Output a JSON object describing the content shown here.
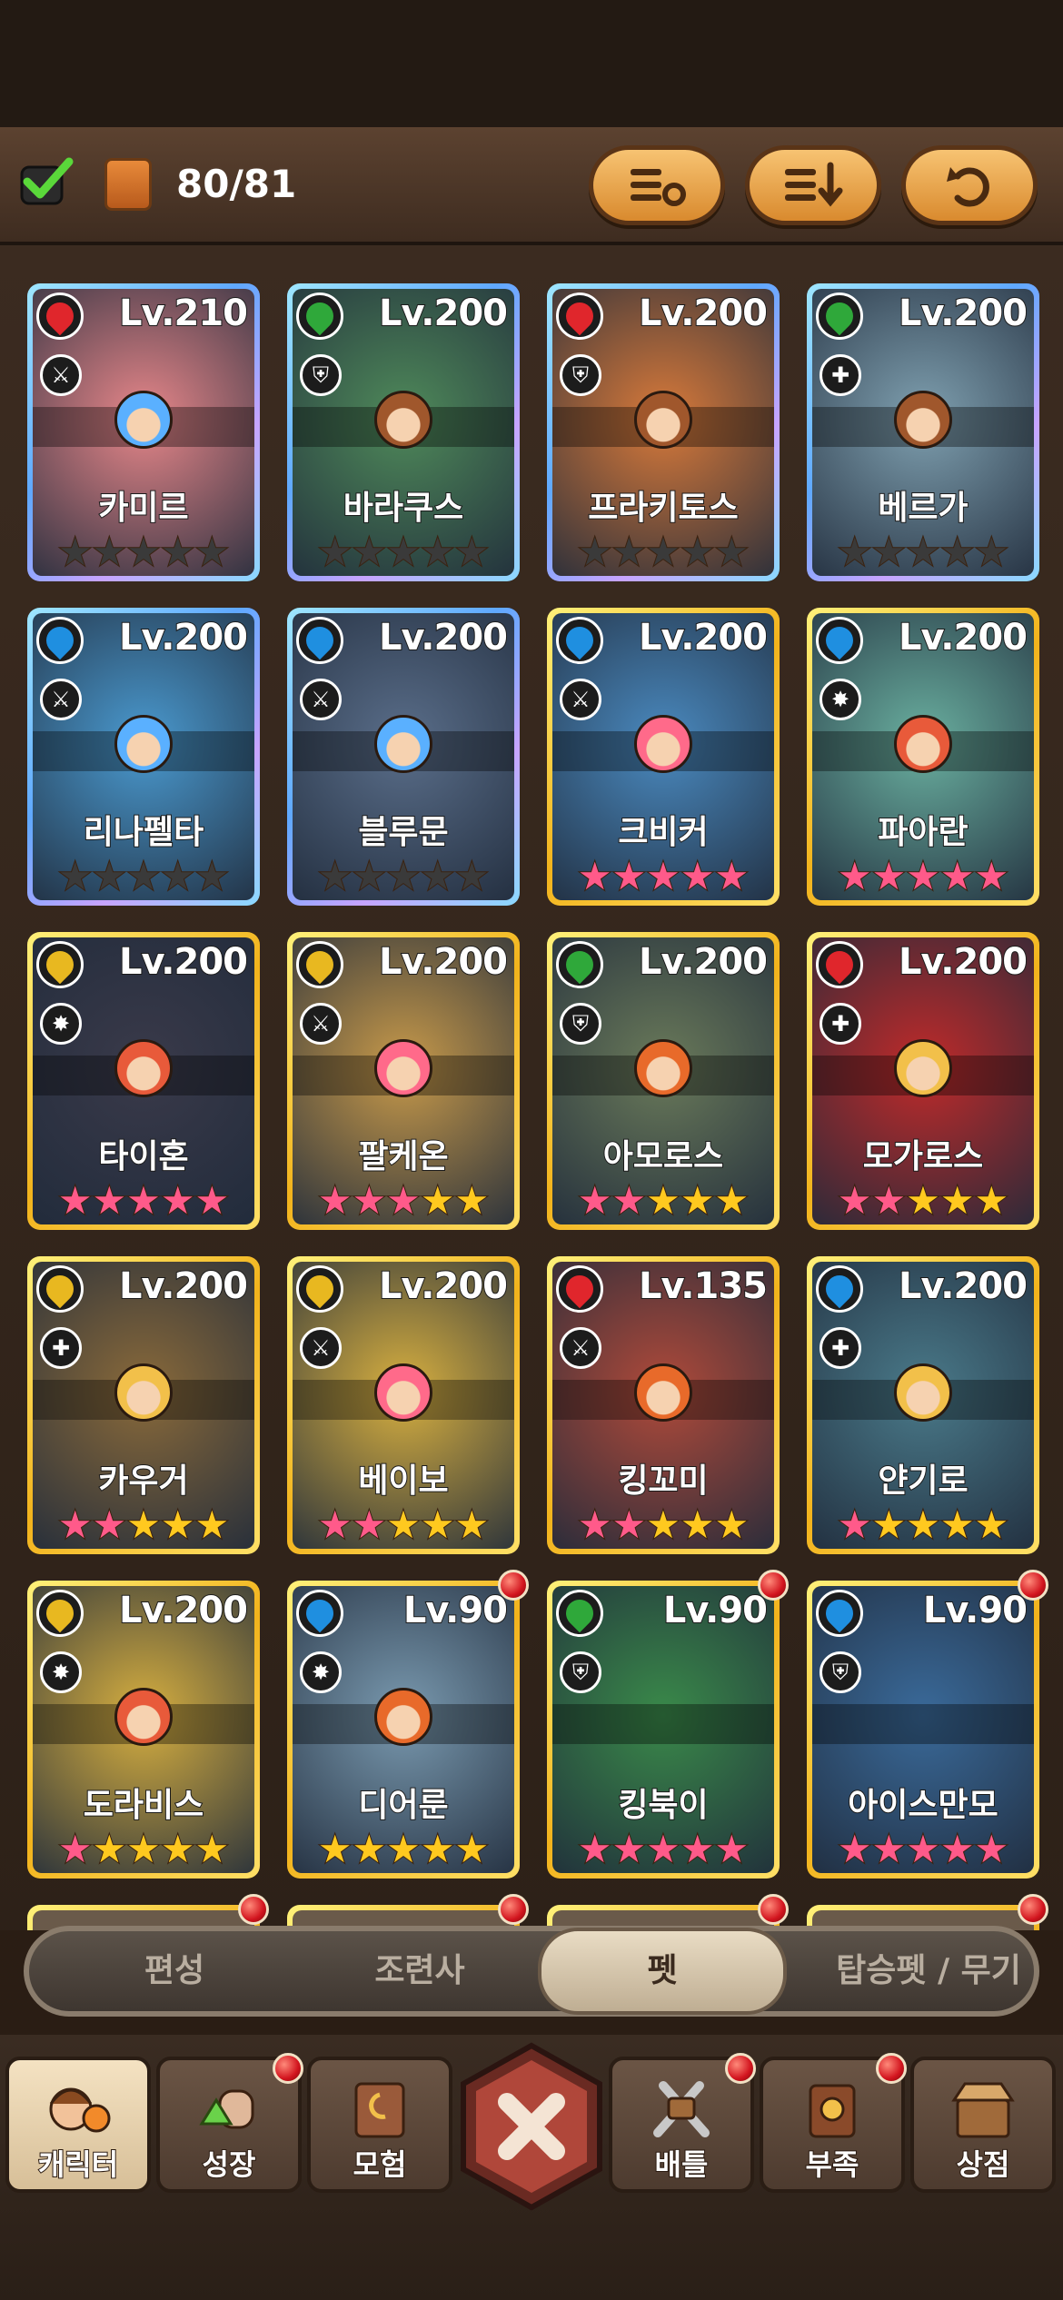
{
  "header": {
    "count": "80/81",
    "buttons": [
      "filter-settings-icon",
      "sort-icon",
      "refresh-icon"
    ]
  },
  "colors": {
    "fire": "#e0262c",
    "nature": "#2fa83a",
    "water": "#1f8fe0",
    "light": "#e8b820"
  },
  "pets": [
    {
      "name": "카미르",
      "level": "Lv.210",
      "element": "fire",
      "role": "⚔",
      "frame": "blue",
      "stars": [
        "d",
        "d",
        "d",
        "d",
        "d"
      ],
      "face": "#5ab0ff",
      "art": "#e8878a",
      "badge": false
    },
    {
      "name": "바라쿠스",
      "level": "Lv.200",
      "element": "nature",
      "role": "⛨",
      "frame": "blue",
      "stars": [
        "d",
        "d",
        "d",
        "d",
        "d"
      ],
      "face": "#a0572c",
      "art": "#4f8a5a",
      "badge": false
    },
    {
      "name": "프라키토스",
      "level": "Lv.200",
      "element": "fire",
      "role": "⛨",
      "frame": "blue",
      "stars": [
        "d",
        "d",
        "d",
        "d",
        "d"
      ],
      "face": "#a0572c",
      "art": "#d97a3a",
      "badge": false
    },
    {
      "name": "베르가",
      "level": "Lv.200",
      "element": "nature",
      "role": "✚",
      "frame": "blue",
      "stars": [
        "d",
        "d",
        "d",
        "d",
        "d"
      ],
      "face": "#a0572c",
      "art": "#7fa0b0",
      "badge": false
    },
    {
      "name": "리나펠타",
      "level": "Lv.200",
      "element": "water",
      "role": "⚔",
      "frame": "blue",
      "stars": [
        "d",
        "d",
        "d",
        "d",
        "d"
      ],
      "face": "#5ab0ff",
      "art": "#4a9ad0",
      "badge": false
    },
    {
      "name": "블루문",
      "level": "Lv.200",
      "element": "water",
      "role": "⚔",
      "frame": "blue",
      "stars": [
        "d",
        "d",
        "d",
        "d",
        "d"
      ],
      "face": "#5ab0ff",
      "art": "#5a6e8a",
      "badge": false
    },
    {
      "name": "크비커",
      "level": "Lv.200",
      "element": "water",
      "role": "⚔",
      "frame": "gold",
      "stars": [
        "p",
        "p",
        "p",
        "p",
        "p"
      ],
      "face": "#ff6a8a",
      "art": "#4a8ac0",
      "badge": false
    },
    {
      "name": "파아란",
      "level": "Lv.200",
      "element": "water",
      "role": "✸",
      "frame": "gold",
      "stars": [
        "p",
        "p",
        "p",
        "p",
        "p"
      ],
      "face": "#e85a3a",
      "art": "#6ab0a0",
      "badge": false
    },
    {
      "name": "타이혼",
      "level": "Lv.200",
      "element": "light",
      "role": "✸",
      "frame": "gold",
      "stars": [
        "p",
        "p",
        "p",
        "p",
        "p"
      ],
      "face": "#e85a3a",
      "art": "#3a3a4a",
      "badge": false
    },
    {
      "name": "팔케온",
      "level": "Lv.200",
      "element": "light",
      "role": "⚔",
      "frame": "gold",
      "stars": [
        "p",
        "p",
        "p",
        "g",
        "g"
      ],
      "face": "#ff6a8a",
      "art": "#c89a4a",
      "badge": false
    },
    {
      "name": "아모로스",
      "level": "Lv.200",
      "element": "nature",
      "role": "⛨",
      "frame": "gold",
      "stars": [
        "p",
        "p",
        "g",
        "g",
        "g"
      ],
      "face": "#e86a2a",
      "art": "#6a7a5a",
      "badge": false
    },
    {
      "name": "모가로스",
      "level": "Lv.200",
      "element": "fire",
      "role": "✚",
      "frame": "gold",
      "stars": [
        "p",
        "p",
        "g",
        "g",
        "g"
      ],
      "face": "#f2c04a",
      "art": "#c02a2a",
      "badge": false
    },
    {
      "name": "카우거",
      "level": "Lv.200",
      "element": "light",
      "role": "✚",
      "frame": "gold",
      "stars": [
        "p",
        "p",
        "g",
        "g",
        "g"
      ],
      "face": "#f2c04a",
      "art": "#8a6a3a",
      "badge": false
    },
    {
      "name": "베이보",
      "level": "Lv.200",
      "element": "light",
      "role": "⚔",
      "frame": "gold",
      "stars": [
        "p",
        "p",
        "g",
        "g",
        "g"
      ],
      "face": "#ff6a8a",
      "art": "#d8b040",
      "badge": false
    },
    {
      "name": "킹꼬미",
      "level": "Lv.135",
      "element": "fire",
      "role": "⚔",
      "frame": "gold",
      "stars": [
        "p",
        "p",
        "g",
        "g",
        "g"
      ],
      "face": "#e86a2a",
      "art": "#b04a3a",
      "badge": false
    },
    {
      "name": "얀기로",
      "level": "Lv.200",
      "element": "water",
      "role": "✚",
      "frame": "gold",
      "stars": [
        "p",
        "g",
        "g",
        "g",
        "g"
      ],
      "face": "#f2c04a",
      "art": "#4a7a8a",
      "badge": false
    },
    {
      "name": "도라비스",
      "level": "Lv.200",
      "element": "light",
      "role": "✸",
      "frame": "gold",
      "stars": [
        "p",
        "g",
        "g",
        "g",
        "g"
      ],
      "face": "#e85a3a",
      "art": "#d8b040",
      "badge": false
    },
    {
      "name": "디어룬",
      "level": "Lv.90",
      "element": "water",
      "role": "✸",
      "frame": "gold",
      "stars": [
        "g",
        "g",
        "g",
        "g",
        "g"
      ],
      "face": "#e86a2a",
      "art": "#7a9ab0",
      "badge": true
    },
    {
      "name": "킹북이",
      "level": "Lv.90",
      "element": "nature",
      "role": "⛨",
      "frame": "gold",
      "stars": [
        "p",
        "p",
        "p",
        "p",
        "p"
      ],
      "face": "",
      "art": "#3a8a4a",
      "badge": true
    },
    {
      "name": "아이스만모",
      "level": "Lv.90",
      "element": "water",
      "role": "⛨",
      "frame": "gold",
      "stars": [
        "p",
        "p",
        "p",
        "p",
        "p"
      ],
      "face": "",
      "art": "#3a6a9a",
      "badge": true
    }
  ],
  "tabs": [
    {
      "label": "편성",
      "active": false
    },
    {
      "label": "조련사",
      "active": false
    },
    {
      "label": "펫",
      "active": true
    },
    {
      "label": "탑승펫 / 무기",
      "active": false
    }
  ],
  "nav": [
    {
      "label": "캐릭터",
      "active": true,
      "badge": false,
      "icon": "character-icon"
    },
    {
      "label": "성장",
      "active": false,
      "badge": true,
      "icon": "growth-icon"
    },
    {
      "label": "모험",
      "active": false,
      "badge": false,
      "icon": "adventure-icon"
    },
    {
      "label": "배틀",
      "active": false,
      "badge": true,
      "icon": "battle-icon"
    },
    {
      "label": "부족",
      "active": false,
      "badge": true,
      "icon": "tribe-icon"
    },
    {
      "label": "상점",
      "active": false,
      "badge": false,
      "icon": "shop-icon"
    }
  ]
}
